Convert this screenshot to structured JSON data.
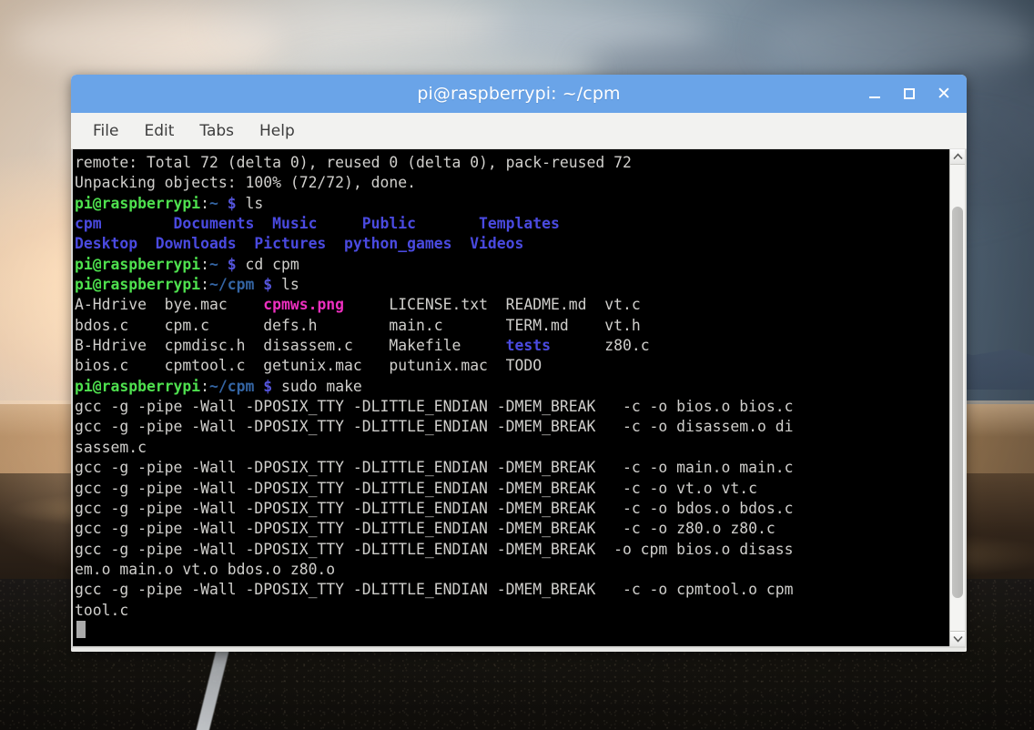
{
  "window": {
    "title": "pi@raspberrypi: ~/cpm",
    "titlebar_color": "#6aa4e8",
    "buttons": {
      "minimize_label": "_",
      "maximize_label": "□",
      "close_label": "✕"
    }
  },
  "menubar": {
    "items": [
      {
        "label": "File"
      },
      {
        "label": "Edit"
      },
      {
        "label": "Tabs"
      },
      {
        "label": "Help"
      }
    ]
  },
  "terminal": {
    "background": "#000000",
    "foreground": "#d0cfcc",
    "prompt_user_host_color": "#4ee04e",
    "prompt_path_color": "#3465a4",
    "dir_color": "#4a4ae0",
    "image_color": "#ee2fc0",
    "cursor": "block",
    "lines": [
      {
        "id": "line-1",
        "segments": [
          {
            "text": "remote: Total 72 (delta 0), reused 0 (delta 0), pack-reused 72",
            "color": "white"
          }
        ]
      },
      {
        "id": "line-2",
        "segments": [
          {
            "text": "Unpacking objects: 100% (72/72), done.",
            "color": "white"
          }
        ]
      },
      {
        "id": "line-3",
        "segments": [
          {
            "text": "pi@raspberrypi",
            "color": "green"
          },
          {
            "text": ":",
            "color": "white"
          },
          {
            "text": "~",
            "color": "blue"
          },
          {
            "text": " ",
            "color": "white"
          },
          {
            "text": "$",
            "color": "promptsym"
          },
          {
            "text": " ls",
            "color": "white"
          }
        ]
      },
      {
        "id": "line-4",
        "segments": [
          {
            "text": "cpm        Documents  Music     Public       Templates",
            "color": "blueb"
          }
        ]
      },
      {
        "id": "line-5",
        "segments": [
          {
            "text": "Desktop  Downloads  Pictures  python_games  Videos",
            "color": "blueb"
          }
        ]
      },
      {
        "id": "line-6",
        "segments": [
          {
            "text": "pi@raspberrypi",
            "color": "green"
          },
          {
            "text": ":",
            "color": "white"
          },
          {
            "text": "~",
            "color": "blue"
          },
          {
            "text": " ",
            "color": "white"
          },
          {
            "text": "$",
            "color": "promptsym"
          },
          {
            "text": " cd cpm",
            "color": "white"
          }
        ]
      },
      {
        "id": "line-7",
        "segments": [
          {
            "text": "pi@raspberrypi",
            "color": "green"
          },
          {
            "text": ":",
            "color": "white"
          },
          {
            "text": "~/cpm",
            "color": "blue"
          },
          {
            "text": " ",
            "color": "white"
          },
          {
            "text": "$",
            "color": "promptsym"
          },
          {
            "text": " ls",
            "color": "white"
          }
        ]
      },
      {
        "id": "line-8",
        "segments": [
          {
            "text": "A-Hdrive  bye.mac    ",
            "color": "white"
          },
          {
            "text": "cpmws.png",
            "color": "magenta"
          },
          {
            "text": "     LICENSE.txt  README.md  vt.c",
            "color": "white"
          }
        ]
      },
      {
        "id": "line-9",
        "segments": [
          {
            "text": "bdos.c    cpm.c      defs.h        main.c       TERM.md    vt.h",
            "color": "white"
          }
        ]
      },
      {
        "id": "line-10",
        "segments": [
          {
            "text": "B-Hdrive  cpmdisc.h  disassem.c    Makefile     ",
            "color": "white"
          },
          {
            "text": "tests",
            "color": "blueb"
          },
          {
            "text": "      z80.c",
            "color": "white"
          }
        ]
      },
      {
        "id": "line-11",
        "segments": [
          {
            "text": "bios.c    cpmtool.c  getunix.mac   putunix.mac  TODO",
            "color": "white"
          }
        ]
      },
      {
        "id": "line-12",
        "segments": [
          {
            "text": "pi@raspberrypi",
            "color": "green"
          },
          {
            "text": ":",
            "color": "white"
          },
          {
            "text": "~/cpm",
            "color": "blue"
          },
          {
            "text": " ",
            "color": "white"
          },
          {
            "text": "$",
            "color": "promptsym"
          },
          {
            "text": " sudo make",
            "color": "white"
          }
        ]
      },
      {
        "id": "line-13",
        "segments": [
          {
            "text": "gcc -g -pipe -Wall -DPOSIX_TTY -DLITTLE_ENDIAN -DMEM_BREAK   -c -o bios.o bios.c",
            "color": "white"
          }
        ]
      },
      {
        "id": "line-14",
        "segments": [
          {
            "text": "gcc -g -pipe -Wall -DPOSIX_TTY -DLITTLE_ENDIAN -DMEM_BREAK   -c -o disassem.o di",
            "color": "white"
          }
        ]
      },
      {
        "id": "line-15",
        "segments": [
          {
            "text": "sassem.c",
            "color": "white"
          }
        ]
      },
      {
        "id": "line-16",
        "segments": [
          {
            "text": "gcc -g -pipe -Wall -DPOSIX_TTY -DLITTLE_ENDIAN -DMEM_BREAK   -c -o main.o main.c",
            "color": "white"
          }
        ]
      },
      {
        "id": "line-17",
        "segments": [
          {
            "text": "gcc -g -pipe -Wall -DPOSIX_TTY -DLITTLE_ENDIAN -DMEM_BREAK   -c -o vt.o vt.c",
            "color": "white"
          }
        ]
      },
      {
        "id": "line-18",
        "segments": [
          {
            "text": "gcc -g -pipe -Wall -DPOSIX_TTY -DLITTLE_ENDIAN -DMEM_BREAK   -c -o bdos.o bdos.c",
            "color": "white"
          }
        ]
      },
      {
        "id": "line-19",
        "segments": [
          {
            "text": "gcc -g -pipe -Wall -DPOSIX_TTY -DLITTLE_ENDIAN -DMEM_BREAK   -c -o z80.o z80.c",
            "color": "white"
          }
        ]
      },
      {
        "id": "line-20",
        "segments": [
          {
            "text": "gcc -g -pipe -Wall -DPOSIX_TTY -DLITTLE_ENDIAN -DMEM_BREAK  -o cpm bios.o disass",
            "color": "white"
          }
        ]
      },
      {
        "id": "line-21",
        "segments": [
          {
            "text": "em.o main.o vt.o bdos.o z80.o",
            "color": "white"
          }
        ]
      },
      {
        "id": "line-22",
        "segments": [
          {
            "text": "gcc -g -pipe -Wall -DPOSIX_TTY -DLITTLE_ENDIAN -DMEM_BREAK   -c -o cpmtool.o cpm",
            "color": "white"
          }
        ]
      },
      {
        "id": "line-23",
        "segments": [
          {
            "text": "tool.c",
            "color": "white"
          }
        ]
      }
    ]
  },
  "scrollbar": {
    "up_arrow": "▲",
    "down_arrow": "▼"
  }
}
